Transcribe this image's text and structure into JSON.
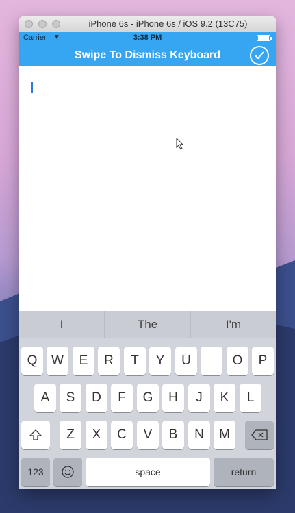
{
  "window": {
    "title": "iPhone 6s - iPhone 6s / iOS 9.2 (13C75)"
  },
  "status_bar": {
    "carrier": "Carrier",
    "time": "3:38 PM",
    "wifi_icon": "wifi-icon",
    "battery_icon": "battery-icon"
  },
  "navbar": {
    "title": "Swipe To Dismiss Keyboard",
    "done_icon": "checkmark-circle-icon",
    "color": "#37a6f2"
  },
  "text_view": {
    "value": ""
  },
  "keyboard": {
    "suggestions": [
      "I",
      "The",
      "I'm"
    ],
    "row1": [
      "Q",
      "W",
      "E",
      "R",
      "T",
      "Y",
      "U",
      "",
      "O",
      "P"
    ],
    "row2": [
      "A",
      "S",
      "D",
      "F",
      "G",
      "H",
      "J",
      "K",
      "L"
    ],
    "row3": [
      "Z",
      "X",
      "C",
      "V",
      "B",
      "N",
      "M"
    ],
    "shift_icon": "shift-icon",
    "backspace_icon": "backspace-icon",
    "numbers_label": "123",
    "emoji_icon": "emoji-icon",
    "space_label": "space",
    "return_label": "return"
  }
}
